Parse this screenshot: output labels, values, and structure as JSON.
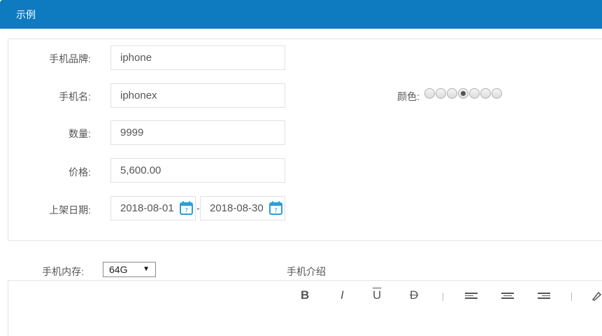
{
  "header": {
    "title": "示例"
  },
  "form": {
    "brand": {
      "label": "手机品牌:",
      "value": "iphone"
    },
    "name": {
      "label": "手机名:",
      "value": "iphonex"
    },
    "quantity": {
      "label": "数量:",
      "value": "9999"
    },
    "price": {
      "label": "价格:",
      "value": "5,600.00"
    },
    "listing_date": {
      "label": "上架日期:",
      "start": "2018-08-01",
      "separator": "-",
      "end": "2018-08-30"
    },
    "color": {
      "label": "颜色:",
      "options_count": 7,
      "selected_index": 3
    },
    "memory": {
      "label": "手机内存:",
      "selected": "64G"
    },
    "intro": {
      "label": "手机介绍"
    }
  },
  "editor_toolbar": {
    "bold": "B",
    "italic": "I",
    "underline": "U",
    "strike": "D"
  },
  "colors": {
    "header_bg": "#0e7ac0",
    "calendar_icon": "#2a9fd8"
  }
}
